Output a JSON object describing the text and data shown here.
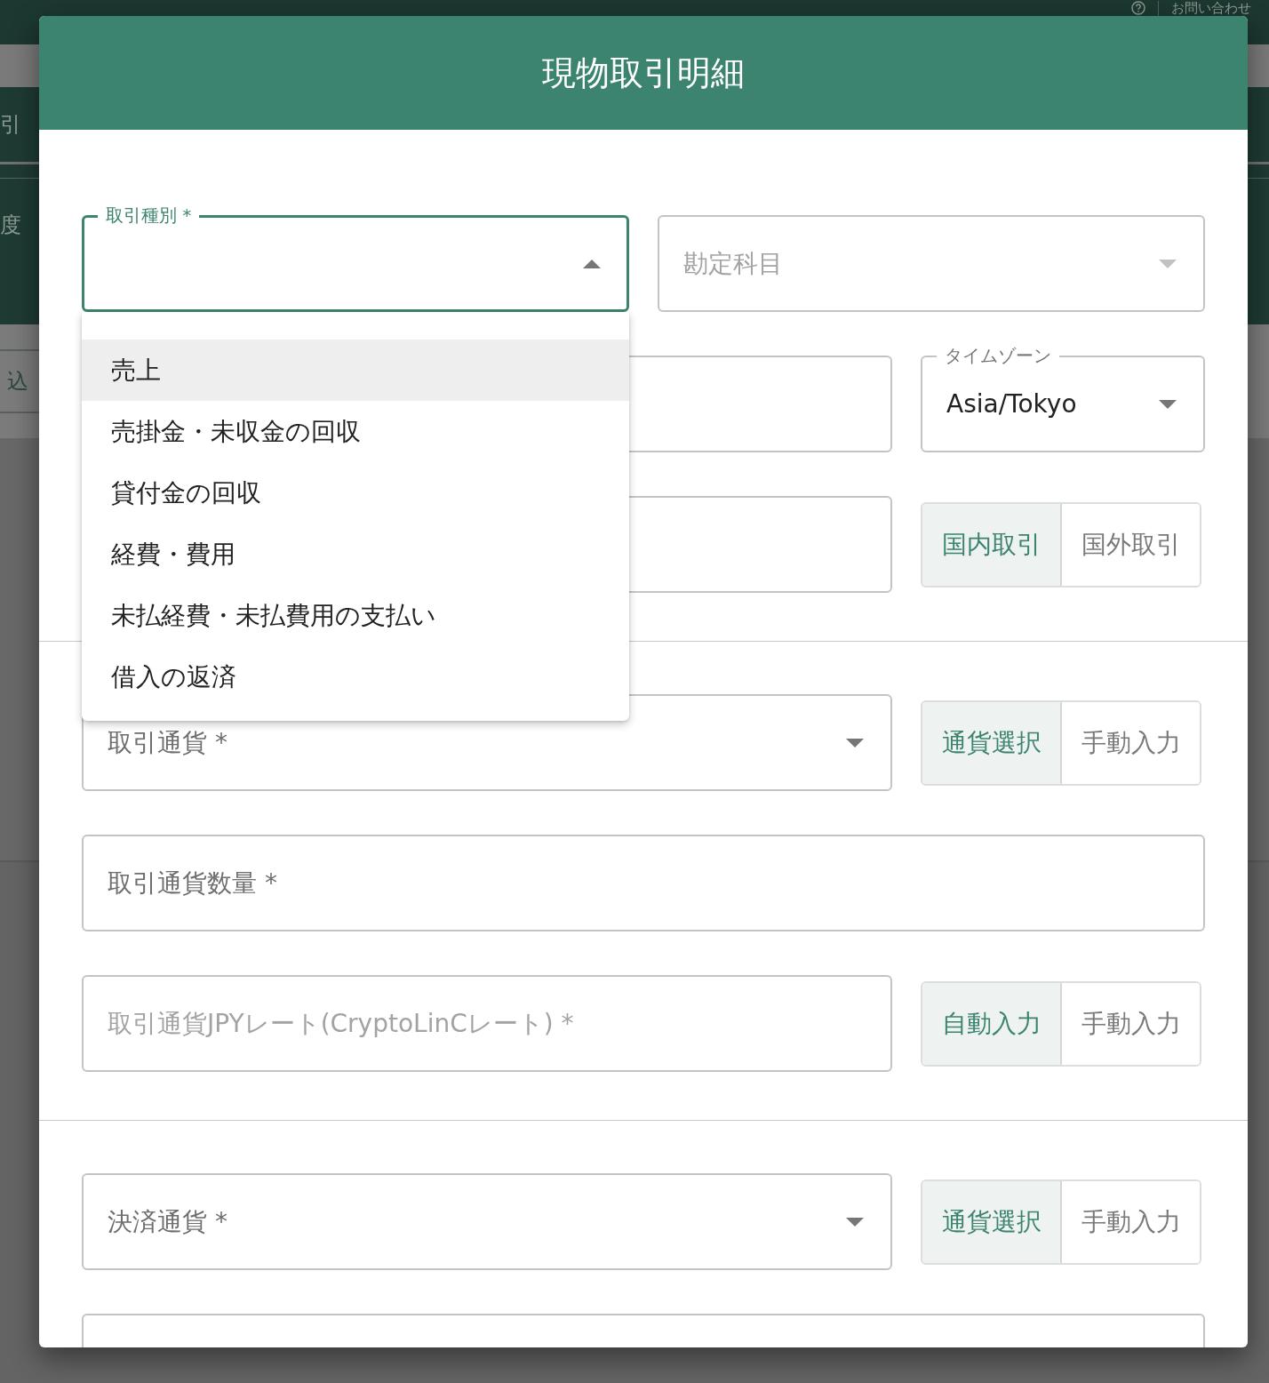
{
  "backdrop": {
    "header": {
      "link": "お問い合わせ"
    },
    "side_tab": "引",
    "side_item": "度",
    "side_button": "込"
  },
  "dialog": {
    "title": "現物取引明細"
  },
  "sections": [
    {
      "rows": [
        [
          {
            "kind": "select",
            "label": "取引種別 *",
            "focused": true,
            "disabled": false,
            "open": true
          },
          {
            "kind": "select",
            "label": "勘定科目",
            "focused": false,
            "disabled": true,
            "open": false
          }
        ],
        [
          {
            "kind": "text",
            "focused": false
          },
          {
            "kind": "select",
            "label": "タイムゾーン",
            "value": "Asia/Tokyo",
            "focused": false,
            "disabled": false,
            "open": false
          }
        ],
        [
          {
            "kind": "text",
            "focused": false
          },
          {
            "kind": "toggle",
            "options": [
              {
                "label": "国内取引",
                "selected": true
              },
              {
                "label": "国外取引",
                "selected": false
              }
            ]
          }
        ]
      ]
    },
    {
      "rows": [
        [
          {
            "kind": "select",
            "label": "取引通貨 *",
            "focused": false,
            "disabled": false,
            "open": false
          },
          {
            "kind": "toggle",
            "options": [
              {
                "label": "通貨選択",
                "selected": true
              },
              {
                "label": "手動入力",
                "selected": false
              }
            ]
          }
        ],
        [
          {
            "kind": "text",
            "label": "取引通貨数量 *",
            "focused": false,
            "disabled": false
          }
        ],
        [
          {
            "kind": "text",
            "label": "取引通貨JPYレート(CryptoLinCレート) *",
            "focused": false,
            "disabled": true
          },
          {
            "kind": "toggle",
            "options": [
              {
                "label": "自動入力",
                "selected": true
              },
              {
                "label": "手動入力",
                "selected": false
              }
            ]
          }
        ]
      ]
    },
    {
      "rows": [
        [
          {
            "kind": "select",
            "label": "決済通貨 *",
            "focused": false,
            "disabled": false,
            "open": false
          },
          {
            "kind": "toggle",
            "options": [
              {
                "label": "通貨選択",
                "selected": true
              },
              {
                "label": "手動入力",
                "selected": false
              }
            ]
          }
        ],
        [
          {
            "kind": "text",
            "focused": false
          }
        ]
      ]
    }
  ],
  "dropdown_menu": [
    {
      "label": "売上",
      "highlighted": true
    },
    {
      "label": "売掛金・未収金の回収",
      "highlighted": false
    },
    {
      "label": "貸付金の回収",
      "highlighted": false
    },
    {
      "label": "経費・費用",
      "highlighted": false
    },
    {
      "label": "未払経費・未払費用の支払い",
      "highlighted": false
    },
    {
      "label": "借入の返済",
      "highlighted": false
    }
  ]
}
